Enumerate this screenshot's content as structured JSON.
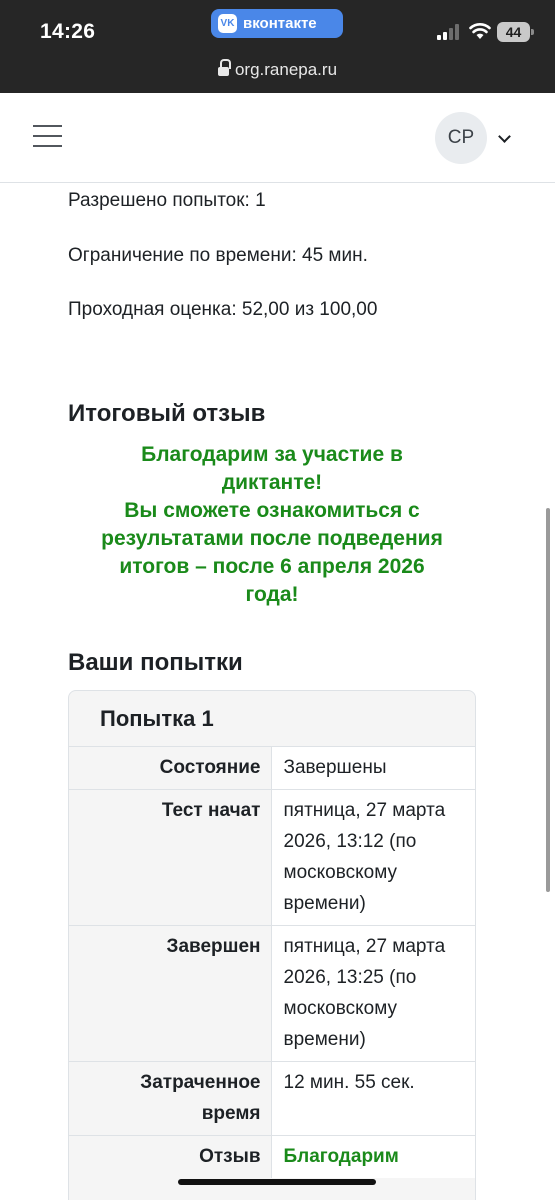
{
  "status_bar": {
    "time": "14:26",
    "app_name": "вконтакте",
    "vk_badge": "VK",
    "battery": "44",
    "url": "org.ranepa.ru"
  },
  "navbar": {
    "avatar_initials": "СР"
  },
  "quiz_info": {
    "attempts_allowed": "Разрешено попыток: 1",
    "time_limit": "Ограничение по времени: 45 мин.",
    "grade_to_pass": "Проходная оценка: 52,00 из 100,00"
  },
  "overall_feedback": {
    "heading": "Итоговый отзыв",
    "line1": "Благодарим за участие в",
    "line2": "диктанте!",
    "line3": "Вы сможете ознакомиться с",
    "line4": "результатами после подведения",
    "line5": "итогов – после 6 апреля 2026",
    "line6": "года!"
  },
  "attempts": {
    "heading": "Ваши попытки",
    "attempt_title": "Попытка 1",
    "rows": {
      "state_label": "Состояние",
      "state_value": "Завершены",
      "started_label": "Тест начат",
      "started_value": "пятница, 27 марта 2026, 13:12 (по московскому времени)",
      "completed_label": "Завершен",
      "completed_value": "пятница, 27 марта 2026, 13:25 (по московскому времени)",
      "time_taken_label": "Затраченное время",
      "time_taken_value": "12 мин. 55 сек.",
      "feedback_label": "Отзыв",
      "feedback_value": "Благодарим"
    }
  },
  "colors": {
    "feedback_green": "#1a8a1a",
    "status_bar": "#262626",
    "vk_blue": "#4a87e8"
  }
}
